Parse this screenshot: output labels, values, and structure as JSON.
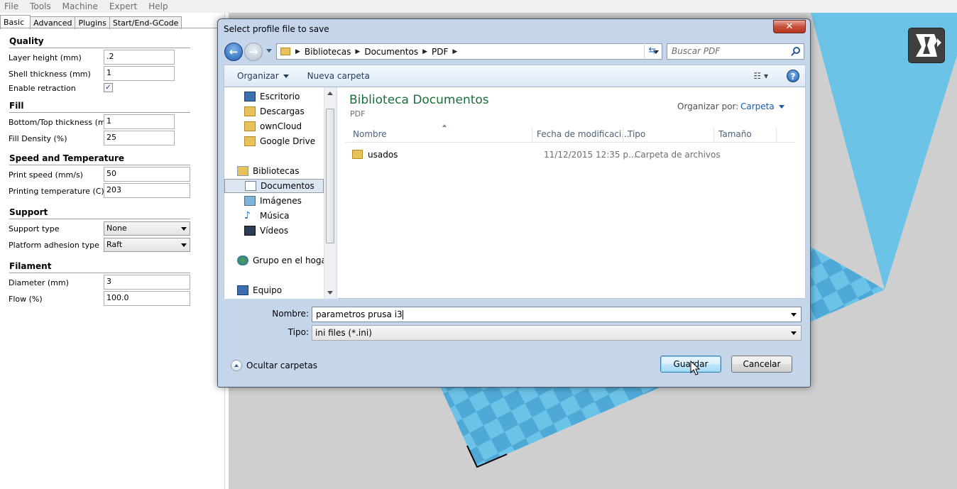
{
  "menubar": [
    "File",
    "Tools",
    "Machine",
    "Expert",
    "Help"
  ],
  "tabs": [
    "Basic",
    "Advanced",
    "Plugins",
    "Start/End-GCode"
  ],
  "sections": {
    "quality": "Quality",
    "fill": "Fill",
    "speed": "Speed and Temperature",
    "support": "Support",
    "filament": "Filament"
  },
  "fields": {
    "layer_height": {
      "label": "Layer height (mm)",
      "value": ".2"
    },
    "shell_thickness": {
      "label": "Shell thickness (mm)",
      "value": "1"
    },
    "enable_retraction": {
      "label": "Enable retraction",
      "checked": "✓"
    },
    "bottom_top": {
      "label": "Bottom/Top thickness (mm)",
      "value": "1"
    },
    "fill_density": {
      "label": "Fill Density (%)",
      "value": "25"
    },
    "print_speed": {
      "label": "Print speed (mm/s)",
      "value": "50"
    },
    "print_temp": {
      "label": "Printing temperature (C)",
      "value": "203"
    },
    "support_type": {
      "label": "Support type",
      "value": "None"
    },
    "platform_adhesion": {
      "label": "Platform adhesion type",
      "value": "Raft"
    },
    "diameter": {
      "label": "Diameter (mm)",
      "value": "3"
    },
    "flow": {
      "label": "Flow (%)",
      "value": "100.0"
    }
  },
  "dialog": {
    "title": "Select profile file to save",
    "close": "✕",
    "breadcrumbs": [
      "Bibliotecas",
      "Documentos",
      "PDF"
    ],
    "search_placeholder": "Buscar PDF",
    "toolbar": {
      "organize": "Organizar",
      "new_folder": "Nueva carpeta"
    },
    "nav": [
      {
        "label": "Escritorio",
        "icon": "desktop-icon"
      },
      {
        "label": "Descargas",
        "icon": "folder-icon"
      },
      {
        "label": "ownCloud",
        "icon": "folder-icon"
      },
      {
        "label": "Google Drive",
        "icon": "folder-icon"
      },
      {
        "label": "Bibliotecas",
        "icon": "library-icon"
      },
      {
        "label": "Documentos",
        "icon": "document-icon"
      },
      {
        "label": "Imágenes",
        "icon": "image-icon"
      },
      {
        "label": "Música",
        "icon": "music-icon"
      },
      {
        "label": "Vídeos",
        "icon": "video-icon"
      },
      {
        "label": "Grupo en el hogar",
        "icon": "homegroup-icon"
      },
      {
        "label": "Equipo",
        "icon": "computer-icon"
      }
    ],
    "library_title": "Biblioteca Documentos",
    "library_sub": "PDF",
    "organize_by_label": "Organizar por:",
    "organize_by_value": "Carpeta",
    "columns": [
      "Nombre",
      "Fecha de modificaci...",
      "Tipo",
      "Tamaño"
    ],
    "rows": [
      {
        "name": "usados",
        "date": "11/12/2015 12:35 p....",
        "type": "Carpeta de archivos",
        "size": ""
      }
    ],
    "name_label": "Nombre:",
    "name_value": "parametros prusa i3",
    "type_label": "Tipo:",
    "type_value": "ini files (*.ini)",
    "hide_folders": "Ocultar carpetas",
    "save_button": "Guardar",
    "cancel_button": "Cancelar"
  },
  "colors": {
    "accent": "#1f5fb4",
    "library_title": "#1c6e3a",
    "viewport_bg": "#cfcfcf",
    "platform_blue": "#6cc3e8"
  }
}
